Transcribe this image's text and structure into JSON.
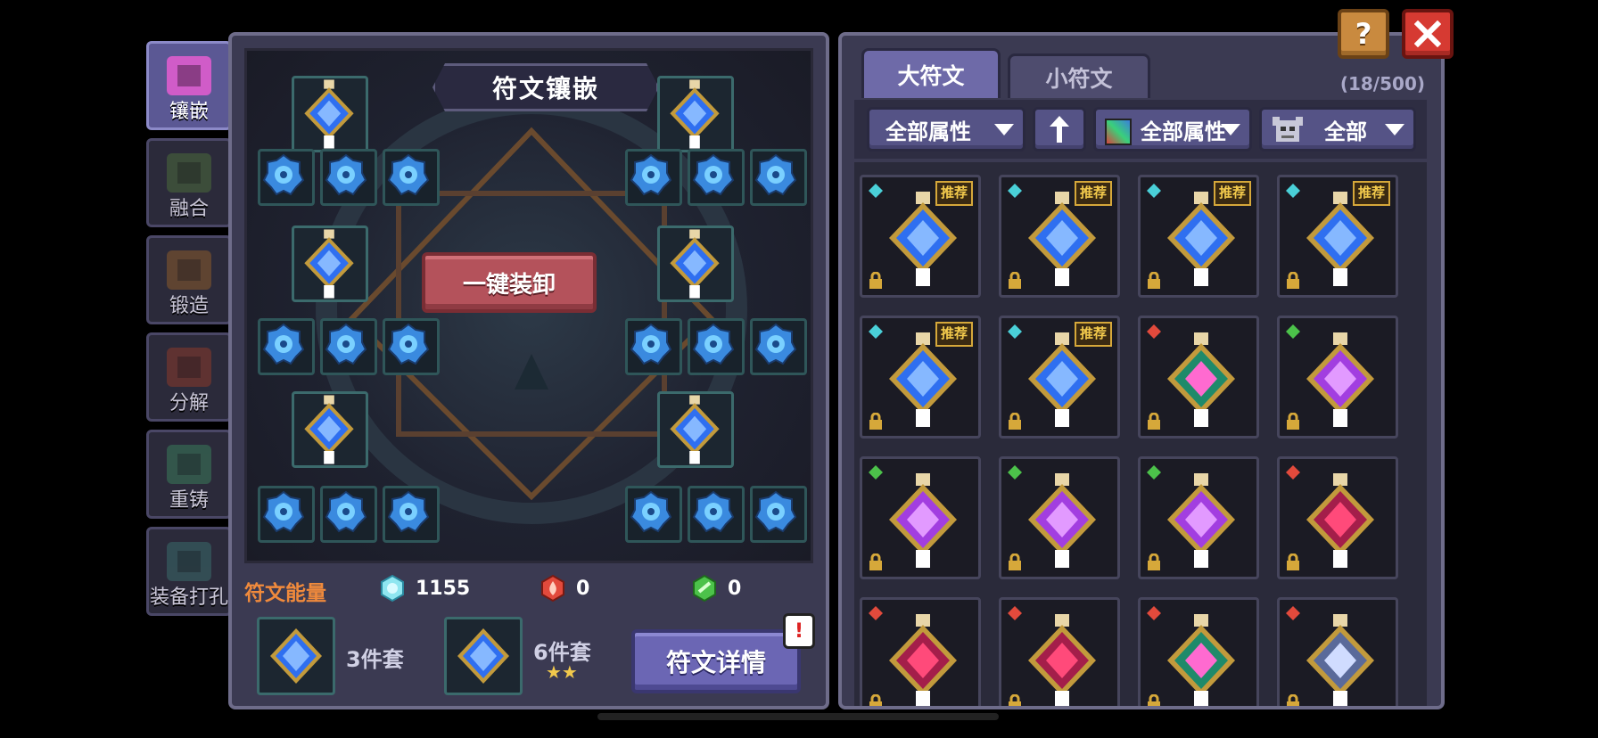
{
  "nav": {
    "items": [
      {
        "label": "镶嵌",
        "icon": "inlay-flask-icon",
        "active": true
      },
      {
        "label": "融合",
        "icon": "fusion-rings-icon",
        "active": false
      },
      {
        "label": "锻造",
        "icon": "forge-chest-icon",
        "active": false
      },
      {
        "label": "分解",
        "icon": "decompose-cross-icon",
        "active": false
      },
      {
        "label": "重铸",
        "icon": "recast-crystals-icon",
        "active": false
      },
      {
        "label": "装备打孔",
        "icon": "socket-drill-icon",
        "active": false
      }
    ]
  },
  "board": {
    "title": "符文镶嵌",
    "unequip_all_label": "一键装卸"
  },
  "energy": {
    "label": "符文能量",
    "blue": "1155",
    "red": "0",
    "green": "0"
  },
  "sets": [
    {
      "label": "3件套",
      "stars": ""
    },
    {
      "label": "6件套",
      "stars": "★★"
    }
  ],
  "detail_button_label": "符文详情",
  "alert_mark": "!",
  "tabs": [
    {
      "label": "大符文",
      "active": true
    },
    {
      "label": "小符文",
      "active": false
    }
  ],
  "counter": "(18/500)",
  "filters": {
    "attribute": "全部属性",
    "sort_icon": "sort-up-arrow-icon",
    "element": "全部属性",
    "type": "全部"
  },
  "inventory": [
    {
      "color": "blue",
      "tag": "cyan",
      "recommended": true
    },
    {
      "color": "blue",
      "tag": "cyan",
      "recommended": true
    },
    {
      "color": "blue",
      "tag": "cyan",
      "recommended": true
    },
    {
      "color": "blue",
      "tag": "cyan",
      "recommended": true
    },
    {
      "color": "blue",
      "tag": "cyan",
      "recommended": true
    },
    {
      "color": "blue",
      "tag": "cyan",
      "recommended": true
    },
    {
      "color": "green",
      "tag": "red",
      "recommended": false
    },
    {
      "color": "purple",
      "tag": "green",
      "recommended": false
    },
    {
      "color": "purple",
      "tag": "green",
      "recommended": false
    },
    {
      "color": "purple",
      "tag": "green",
      "recommended": false
    },
    {
      "color": "purple",
      "tag": "green",
      "recommended": false
    },
    {
      "color": "crimson",
      "tag": "red",
      "recommended": false
    },
    {
      "color": "crimson",
      "tag": "red",
      "recommended": false
    },
    {
      "color": "crimson",
      "tag": "red",
      "recommended": false
    },
    {
      "color": "green",
      "tag": "red",
      "recommended": false
    },
    {
      "color": "silver",
      "tag": "red",
      "recommended": false
    }
  ],
  "recommended_label": "推荐",
  "colors": {
    "rune_blue": "#2f6ff0",
    "rune_purple": "#a23ee0",
    "rune_green": "#2fbf7a",
    "rune_crimson": "#c4245a",
    "rune_silver": "#8fa0c8",
    "accent_orange": "#f08a3c",
    "gold": "#d6a83a"
  }
}
